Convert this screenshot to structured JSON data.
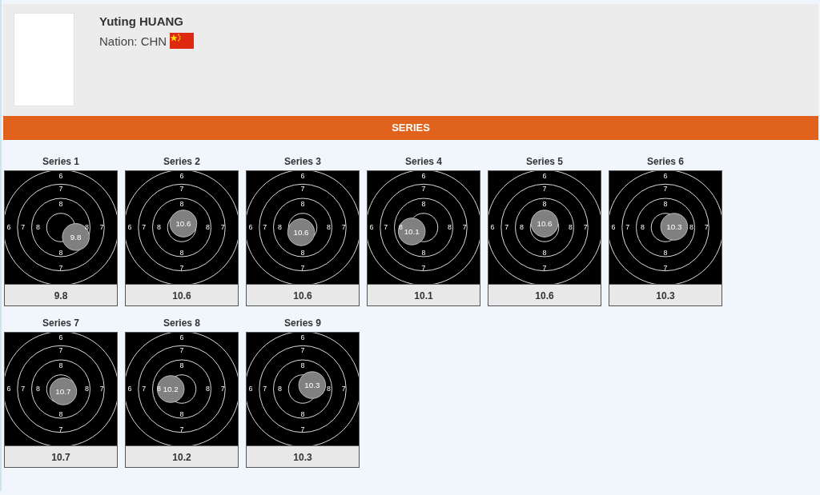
{
  "athlete": {
    "name": "Yuting HUANG",
    "nation_label": "Nation: CHN"
  },
  "section": {
    "title": "SERIES"
  },
  "series": [
    {
      "title": "Series 1",
      "shot": "9.8",
      "score": "9.8",
      "ring_labels": [
        "6",
        "7",
        "8",
        "6",
        "7",
        "8",
        "8",
        "7",
        "8",
        "7"
      ]
    },
    {
      "title": "Series 2",
      "shot": "10.6",
      "score": "10.6",
      "ring_labels": [
        "6",
        "7",
        "8",
        "6",
        "7",
        "8",
        "8",
        "7",
        "8",
        "7"
      ]
    },
    {
      "title": "Series 3",
      "shot": "10.6",
      "score": "10.6",
      "ring_labels": [
        "6",
        "7",
        "8",
        "6",
        "7",
        "8",
        "8",
        "7",
        "8",
        "7"
      ]
    },
    {
      "title": "Series 4",
      "shot": "10.1",
      "score": "10.1",
      "ring_labels": [
        "6",
        "7",
        "8",
        "6",
        "7",
        "8",
        "8",
        "7",
        "8",
        "7"
      ]
    },
    {
      "title": "Series 5",
      "shot": "10.6",
      "score": "10.6",
      "ring_labels": [
        "6",
        "7",
        "8",
        "6",
        "7",
        "8",
        "8",
        "7",
        "8",
        "7"
      ]
    },
    {
      "title": "Series 6",
      "shot": "10.3",
      "score": "10.3",
      "ring_labels": [
        "6",
        "7",
        "8",
        "6",
        "7",
        "8",
        "8",
        "7",
        "8",
        "7"
      ]
    },
    {
      "title": "Series 7",
      "shot": "10.7",
      "score": "10.7",
      "ring_labels": [
        "6",
        "7",
        "8",
        "6",
        "7",
        "8",
        "8",
        "7",
        "8",
        "7"
      ]
    },
    {
      "title": "Series 8",
      "shot": "10.2",
      "score": "10.2",
      "ring_labels": [
        "6",
        "7",
        "8",
        "6",
        "7",
        "8",
        "8",
        "7",
        "8",
        "7"
      ]
    },
    {
      "title": "Series 9",
      "shot": "10.3",
      "score": "10.3",
      "ring_labels": [
        "6",
        "7",
        "8",
        "6",
        "7",
        "8",
        "8",
        "7",
        "8",
        "7"
      ]
    }
  ]
}
